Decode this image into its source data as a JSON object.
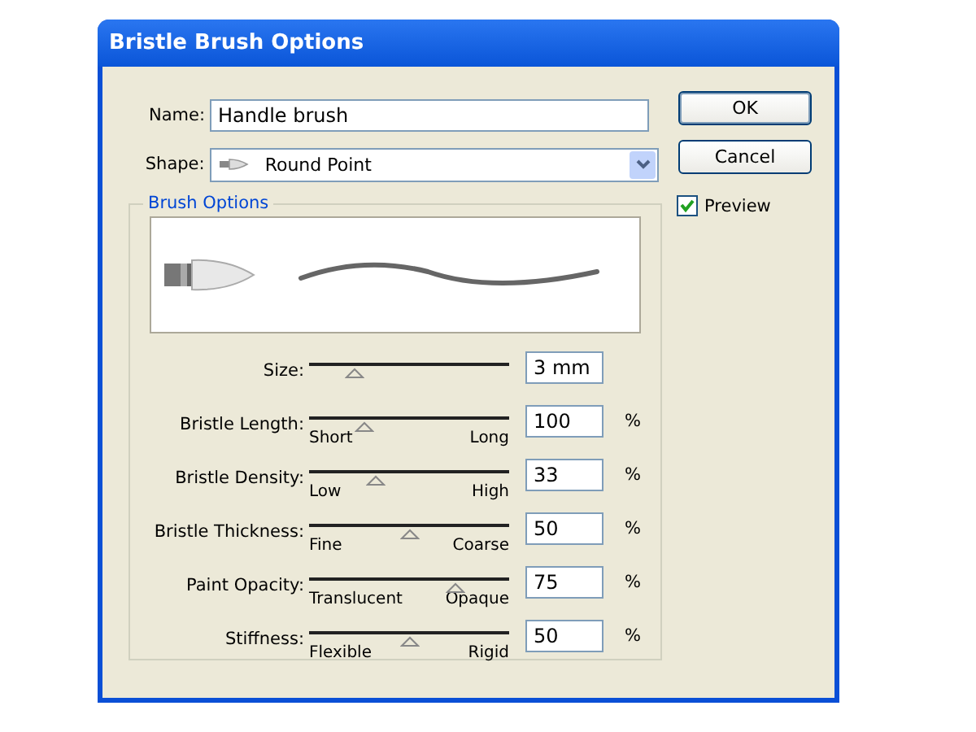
{
  "window": {
    "title": "Bristle Brush Options"
  },
  "name": {
    "label": "Name:",
    "value": "Handle brush"
  },
  "shape": {
    "label": "Shape:",
    "value": "Round Point"
  },
  "buttons": [
    {
      "label": "OK",
      "default": true
    },
    {
      "label": "Cancel",
      "default": false
    }
  ],
  "preview": {
    "label": "Preview",
    "checked": true
  },
  "group": {
    "title": "Brush Options"
  },
  "sliders": [
    {
      "label": "Size:",
      "level": 0.23,
      "value": "3 mm"
    },
    {
      "label": "Bristle Length:",
      "min_label": "Short",
      "max_label": "Long",
      "level": 0.28,
      "value": "100",
      "unit": "%"
    },
    {
      "label": "Bristle Density:",
      "min_label": "Low",
      "max_label": "High",
      "level": 0.33,
      "value": "33",
      "unit": "%"
    },
    {
      "label": "Bristle Thickness:",
      "min_label": "Fine",
      "max_label": "Coarse",
      "level": 0.5,
      "value": "50",
      "unit": "%"
    },
    {
      "label": "Paint Opacity:",
      "min_label": "Translucent",
      "max_label": "Opaque",
      "level": 0.73,
      "value": "75",
      "unit": "%"
    },
    {
      "label": "Stiffness:",
      "min_label": "Flexible",
      "max_label": "Rigid",
      "level": 0.5,
      "value": "50",
      "unit": "%"
    }
  ]
}
